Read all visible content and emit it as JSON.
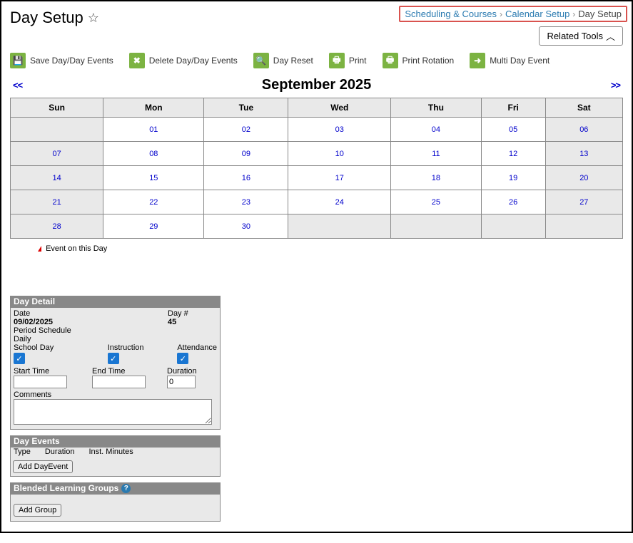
{
  "header": {
    "title": "Day Setup",
    "breadcrumbs": {
      "a": "Scheduling & Courses",
      "b": "Calendar Setup",
      "c": "Day Setup"
    },
    "related_tools": "Related Tools"
  },
  "toolbar": {
    "save": "Save Day/Day Events",
    "delete": "Delete Day/Day Events",
    "reset": "Day Reset",
    "print": "Print",
    "rotation": "Print Rotation",
    "multi": "Multi Day Event"
  },
  "calendar": {
    "prev": "<<",
    "next": ">>",
    "month_title": "September 2025",
    "dow": {
      "sun": "Sun",
      "mon": "Mon",
      "tue": "Tue",
      "wed": "Wed",
      "thu": "Thu",
      "fri": "Fri",
      "sat": "Sat"
    },
    "rows": [
      [
        "",
        "01",
        "02",
        "03",
        "04",
        "05",
        "06"
      ],
      [
        "07",
        "08",
        "09",
        "10",
        "11",
        "12",
        "13"
      ],
      [
        "14",
        "15",
        "16",
        "17",
        "18",
        "19",
        "20"
      ],
      [
        "21",
        "22",
        "23",
        "24",
        "25",
        "26",
        "27"
      ],
      [
        "28",
        "29",
        "30",
        "",
        "",
        "",
        ""
      ]
    ],
    "legend": "Event on this Day"
  },
  "day_detail": {
    "panel_title": "Day Detail",
    "date_label": "Date",
    "date_value": "09/02/2025",
    "daynum_label": "Day #",
    "daynum_value": "45",
    "period_sched_label": "Period Schedule",
    "period_sched_value": "Daily",
    "schoolday": "School Day",
    "instruction": "Instruction",
    "attendance": "Attendance",
    "start_time": "Start Time",
    "end_time": "End Time",
    "duration_label": "Duration",
    "duration_value": "0",
    "comments_label": "Comments"
  },
  "day_events": {
    "panel_title": "Day Events",
    "col_type": "Type",
    "col_duration": "Duration",
    "col_inst": "Inst. Minutes",
    "add_btn": "Add DayEvent"
  },
  "blg": {
    "panel_title": "Blended Learning Groups",
    "add_btn": "Add Group"
  }
}
